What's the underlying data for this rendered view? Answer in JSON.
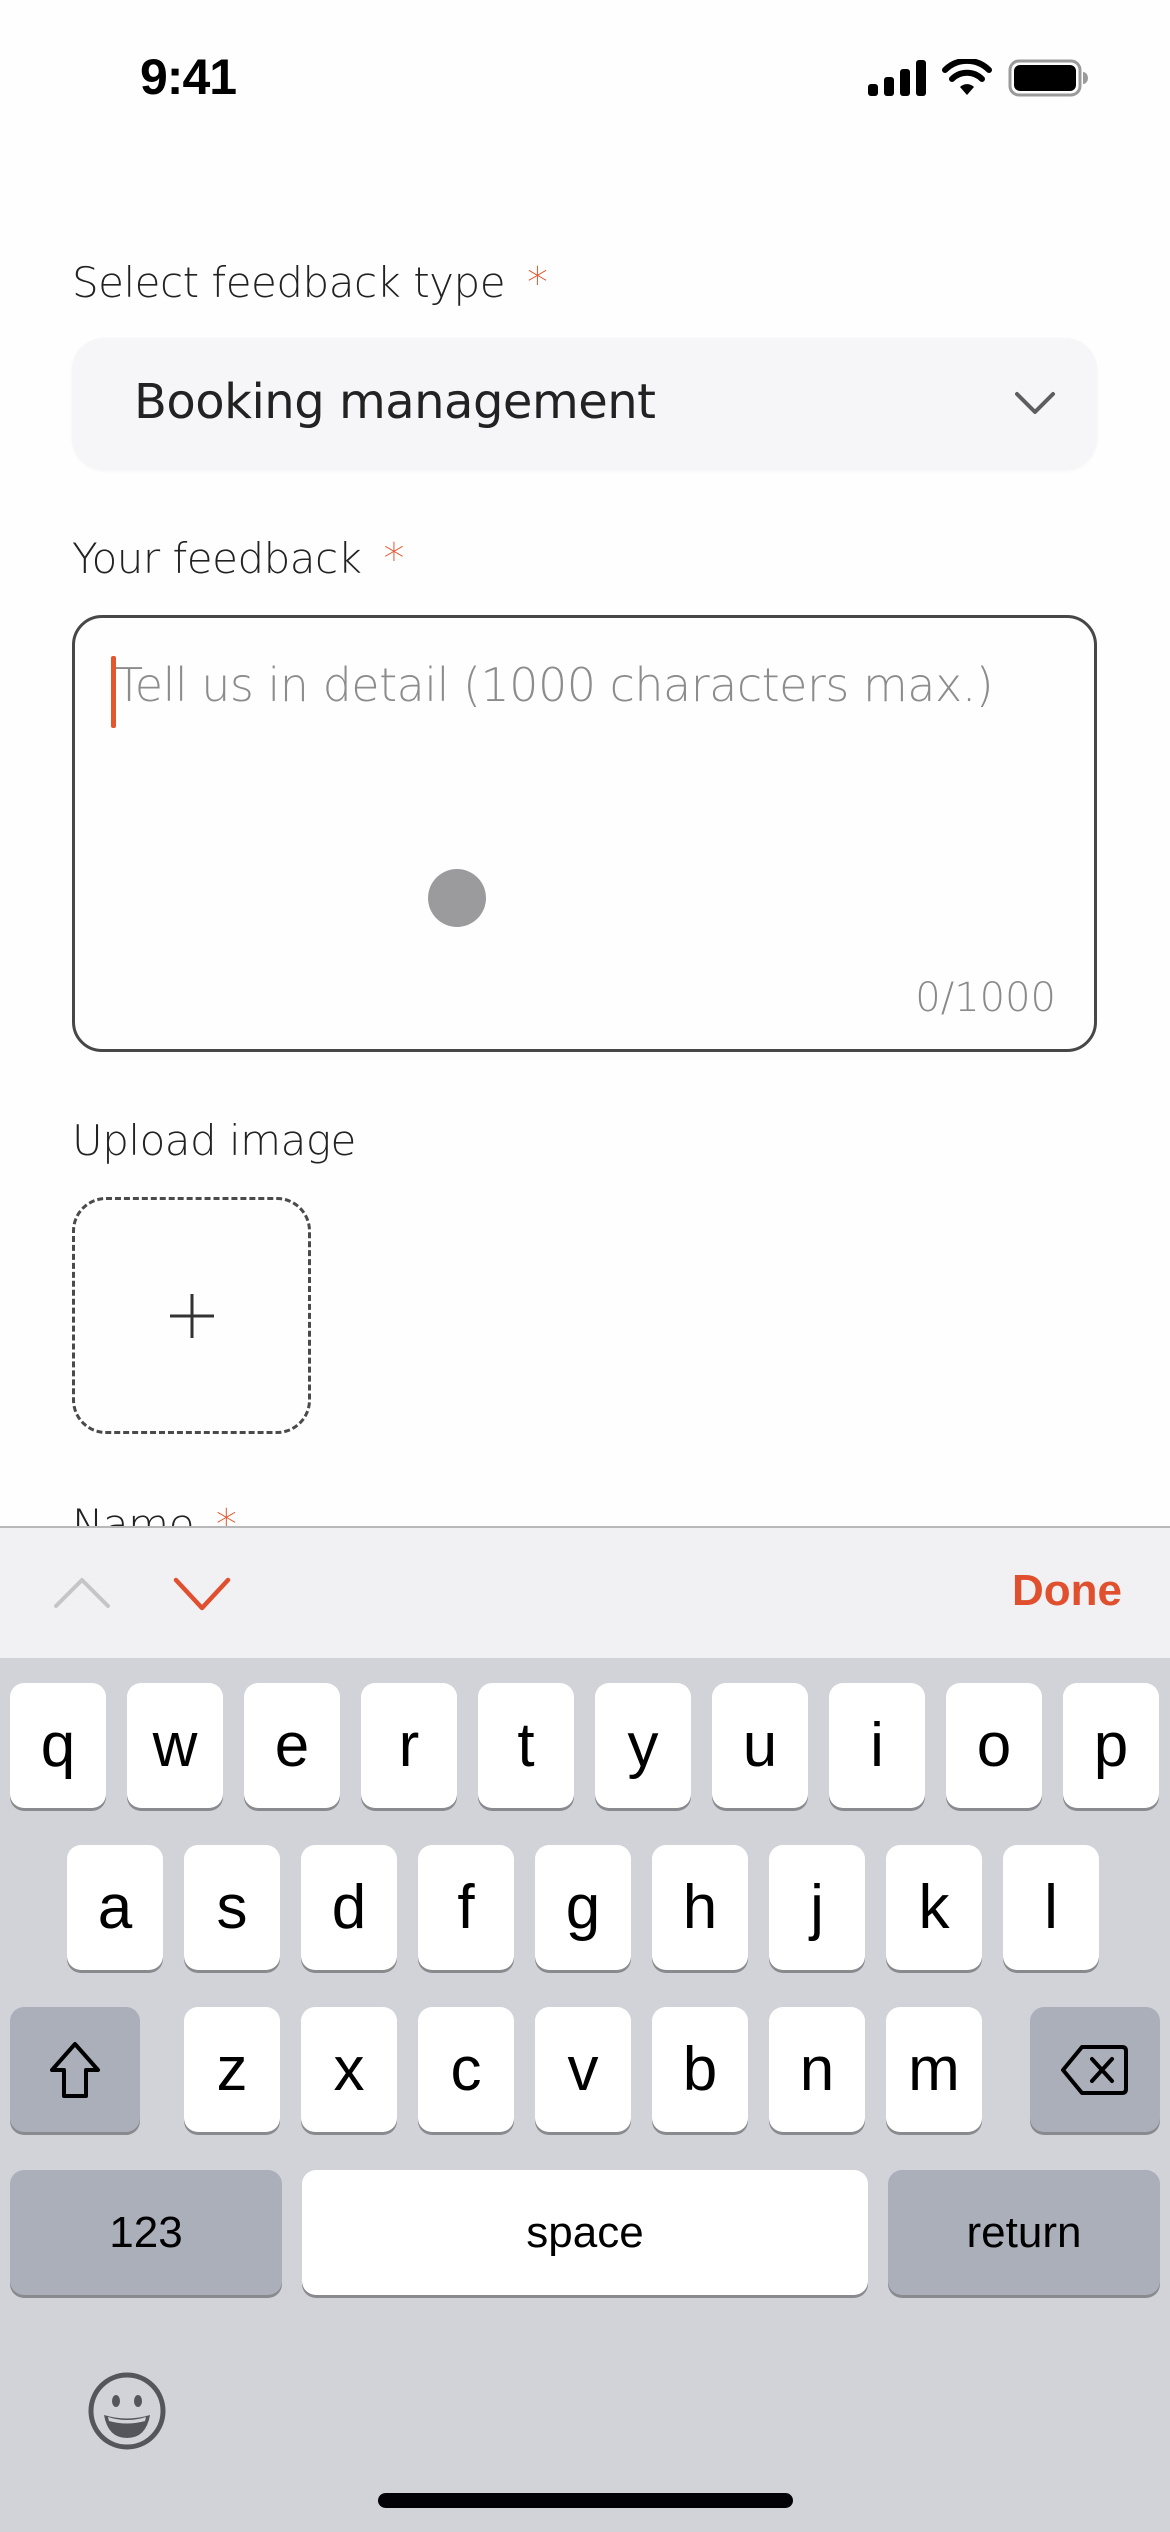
{
  "status_bar": {
    "time": "9:41",
    "icons": [
      "cellular-signal-icon",
      "wifi-icon",
      "battery-icon"
    ]
  },
  "form": {
    "feedback_type": {
      "label": "Select feedback type",
      "required_mark": "*",
      "selected_value": "Booking management",
      "icon": "chevron-down-icon"
    },
    "feedback": {
      "label": "Your feedback",
      "required_mark": "*",
      "value": "",
      "placeholder": "Tell us in detail (1000 characters max.)",
      "counter": "0/1000"
    },
    "upload": {
      "label": "Upload image",
      "icon": "plus-icon"
    },
    "name": {
      "label": "Name",
      "required_mark": "*"
    }
  },
  "toolbar": {
    "prev_icon": "chevron-up-icon",
    "next_icon": "chevron-down-icon",
    "done_label": "Done"
  },
  "keyboard": {
    "row1": [
      "q",
      "w",
      "e",
      "r",
      "t",
      "y",
      "u",
      "i",
      "o",
      "p"
    ],
    "row2": [
      "a",
      "s",
      "d",
      "f",
      "g",
      "h",
      "j",
      "k",
      "l"
    ],
    "row3": [
      "z",
      "x",
      "c",
      "v",
      "b",
      "n",
      "m"
    ],
    "shift_icon": "shift-icon",
    "delete_icon": "delete-icon",
    "numbers_label": "123",
    "space_label": "space",
    "return_label": "return",
    "emoji_icon": "emoji-icon"
  },
  "colors": {
    "accent": "#e0502e",
    "required": "#e4572e",
    "keyboard_bg": "#d1d3d9",
    "toolbar_bg": "#f1f0f3"
  }
}
